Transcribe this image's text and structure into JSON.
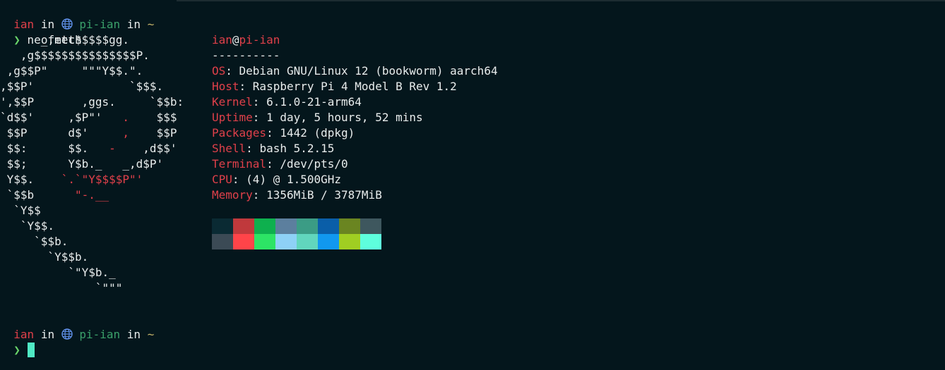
{
  "prompt1": {
    "user": "ian",
    "in1": "in",
    "globe_icon": "globe-icon",
    "host": "pi-ian",
    "in2": "in",
    "dir": "~"
  },
  "command": {
    "arrow": "❯",
    "text": "neofetch"
  },
  "logo": {
    "lines": [
      [
        "      _,met$$$$$gg.",
        "",
        ""
      ],
      [
        "   ,g$$$$$$$$$$$$$$$P.",
        "",
        ""
      ],
      [
        " ,g$$P\"     \"\"\"Y$$.\".",
        "",
        ""
      ],
      [
        ",$$P'              `$$$.",
        "",
        ""
      ],
      [
        "',$$P       ,ggs.     `$$b:",
        "",
        ""
      ],
      [
        "`d$$'     ,$P\"'   ",
        ".",
        "    $$$"
      ],
      [
        " $$P      d$'     ",
        ",",
        "    $$P"
      ],
      [
        " $$:      $$.   ",
        "-",
        "    ,d$$'"
      ],
      [
        " $$;      Y$b._   _,d$P'",
        "",
        ""
      ],
      [
        " Y$$.    ",
        "`.`\"Y$$$$P\"'",
        ""
      ],
      [
        " `$$b      ",
        "\"-.__",
        ""
      ],
      [
        "  `Y$$",
        "",
        ""
      ],
      [
        "   `Y$$.",
        "",
        ""
      ],
      [
        "     `$$b.",
        "",
        ""
      ],
      [
        "       `Y$$b.",
        "",
        ""
      ],
      [
        "          `\"Y$b._",
        "",
        ""
      ],
      [
        "              `\"\"\"",
        "",
        ""
      ]
    ]
  },
  "info": {
    "user": "ian",
    "at": "@",
    "host": "pi-ian",
    "separator": "----------",
    "fields": [
      {
        "key": "OS",
        "value": ": Debian GNU/Linux 12 (bookworm) aarch64"
      },
      {
        "key": "Host",
        "value": ": Raspberry Pi 4 Model B Rev 1.2"
      },
      {
        "key": "Kernel",
        "value": ": 6.1.0-21-arm64"
      },
      {
        "key": "Uptime",
        "value": ": 1 day, 5 hours, 52 mins"
      },
      {
        "key": "Packages",
        "value": ": 1442 (dpkg)"
      },
      {
        "key": "Shell",
        "value": ": bash 5.2.15"
      },
      {
        "key": "Terminal",
        "value": ": /dev/pts/0"
      },
      {
        "key": "CPU",
        "value": ": (4) @ 1.500GHz"
      },
      {
        "key": "Memory",
        "value": ": 1356MiB / 3787MiB"
      }
    ]
  },
  "palette": {
    "row1": [
      "#0a2a33",
      "#c0393c",
      "#0eb04e",
      "#5c7f9e",
      "#3b9c85",
      "#0a5ea8",
      "#6a8521",
      "#3e575e"
    ],
    "row2": [
      "#3b4a55",
      "#ff4449",
      "#2de465",
      "#8ed1f6",
      "#61d6bd",
      "#1198ef",
      "#a0ce22",
      "#5efedd"
    ]
  },
  "prompt2": {
    "user": "ian",
    "in1": "in",
    "globe_icon": "globe-icon",
    "host": "pi-ian",
    "in2": "in",
    "dir": "~",
    "arrow": "❯"
  }
}
